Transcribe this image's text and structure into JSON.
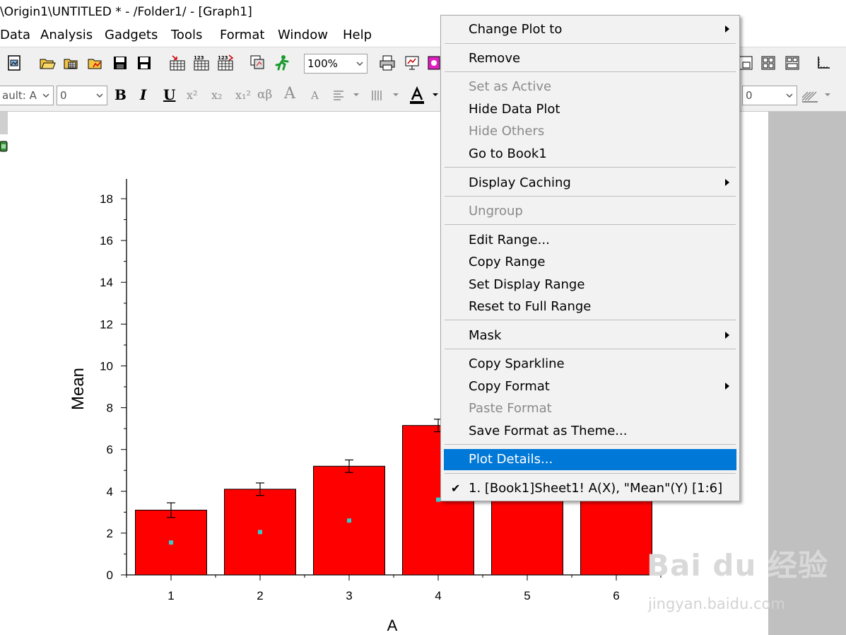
{
  "window": {
    "title": "\\Origin1\\UNTITLED * - /Folder1/ - [Graph1]"
  },
  "menubar": {
    "items": [
      "Data",
      "Analysis",
      "Gadgets",
      "Tools",
      "Format",
      "Window",
      "Help"
    ]
  },
  "toolbar": {
    "zoom": "100%",
    "font_name": "ault: A",
    "font_size": "0",
    "right_size": "0"
  },
  "formatting": {
    "bold": "B",
    "italic": "I",
    "underline": "U",
    "superscript": "x²",
    "subscript": "x₂",
    "supsub": "x₁²",
    "greek": "αβ",
    "grow": "A",
    "shrink": "A"
  },
  "context_menu": {
    "items": [
      {
        "label": "Change Plot to",
        "submenu": true
      },
      {
        "label": "Remove"
      },
      {
        "label": "Set as Active",
        "disabled": true
      },
      {
        "label": "Hide Data Plot"
      },
      {
        "label": "Hide Others",
        "disabled": true
      },
      {
        "label": "Go to Book1"
      },
      {
        "label": "Display Caching",
        "submenu": true
      },
      {
        "label": "Ungroup",
        "disabled": true
      },
      {
        "label": "Edit Range..."
      },
      {
        "label": "Copy Range"
      },
      {
        "label": "Set Display Range"
      },
      {
        "label": "Reset to Full Range"
      },
      {
        "label": "Mask",
        "submenu": true
      },
      {
        "label": "Copy Sparkline"
      },
      {
        "label": "Copy Format",
        "submenu": true
      },
      {
        "label": "Paste Format",
        "disabled": true
      },
      {
        "label": "Save Format as Theme..."
      },
      {
        "label": "Plot Details...",
        "highlighted": true
      },
      {
        "label": "1. [Book1]Sheet1! A(X), \"Mean\"(Y) [1:6]",
        "checked": true
      }
    ]
  },
  "colors": {
    "bar": "#ff0000",
    "marker": "#33cccc",
    "highlight": "#0078d7"
  },
  "chart_data": {
    "type": "bar",
    "categories": [
      "1",
      "2",
      "3",
      "4",
      "5",
      "6"
    ],
    "values": [
      3.1,
      4.1,
      5.2,
      7.15,
      7.5,
      8.0
    ],
    "errors": [
      0.35,
      0.3,
      0.3,
      0.3,
      0.3,
      0.3
    ],
    "markers": [
      1.55,
      2.05,
      2.6,
      3.6,
      3.75,
      4.0
    ],
    "xlabel": "A",
    "ylabel": "Mean",
    "ylim": [
      0,
      19
    ],
    "yticks": [
      0,
      2,
      4,
      6,
      8,
      10,
      12,
      14,
      16,
      18
    ]
  },
  "watermark": {
    "logo": "Bai du 经验",
    "url": "jingyan.baidu.com"
  }
}
